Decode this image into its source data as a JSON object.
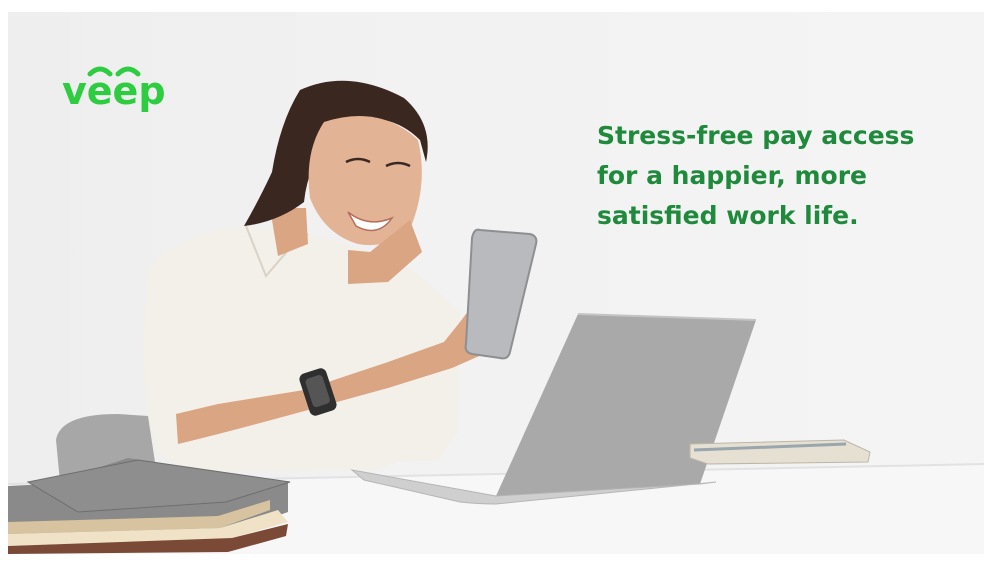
{
  "brand": {
    "logo_text": "veep",
    "logo_color": "#2ecc40"
  },
  "headline": {
    "line1": "Stress-free pay access",
    "line2": "for a happier, more",
    "line3": "satisfied work life.",
    "color": "#1f8a3b"
  },
  "photo": {
    "subject": "smiling woman at desk holding phone with laptop and books"
  }
}
